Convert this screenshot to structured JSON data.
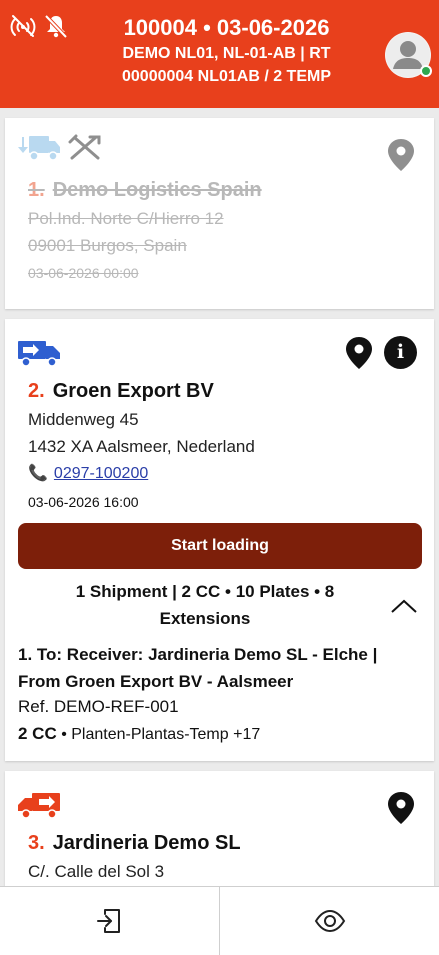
{
  "header": {
    "line1": "100004 • 03-06-2026",
    "line2": "DEMO NL01, NL-01-AB | RT",
    "line3": "00000004 NL01AB / 2 TEMP",
    "icons": [
      "signal-icon",
      "notifications-off-icon"
    ],
    "status_color": "#2fa84f",
    "brand_color": "#e8401c"
  },
  "stops": [
    {
      "number": "1.",
      "name": "Demo Logistics Spain",
      "address1": "Pol.Ind. Norte C/Hierro 12",
      "address2": "09001 Burgos, Spain",
      "datetime": "03-06-2026 00:00",
      "completed": true,
      "icons": [
        "truck-unload-icon",
        "crossed-tools-icon",
        "location-pin-icon"
      ]
    },
    {
      "number": "2.",
      "name": "Groen Export BV",
      "address1": "Middenweg 45",
      "address2": "1432 XA Aalsmeer, Nederland",
      "phone": "0297-100200",
      "datetime": "03-06-2026 16:00",
      "action": "Start loading",
      "action_color": "#7d1f0a",
      "icons": [
        "truck-load-icon",
        "location-pin-icon",
        "info-icon"
      ],
      "shipments": {
        "summary": "1 Shipment | 2 CC • 10 Plates • 8 Extensions",
        "expanded": true,
        "items": [
          {
            "title": "1. To: Receiver: Jardineria Demo SL - Elche | From Groen Export BV - Aalsmeer",
            "ref": "Ref. DEMO-REF-001",
            "cc": "2 CC",
            "goods": "• Planten-Plantas-Temp +17"
          }
        ]
      }
    },
    {
      "number": "3.",
      "name": "Jardineria Demo SL",
      "address1": "C/. Calle del Sol 3",
      "icons": [
        "truck-deliver-icon",
        "location-pin-icon"
      ]
    }
  ],
  "bottom_nav": [
    {
      "name": "exit",
      "icon": "sign-out-icon"
    },
    {
      "name": "view",
      "icon": "eye-icon"
    }
  ],
  "info_glyph": "i"
}
